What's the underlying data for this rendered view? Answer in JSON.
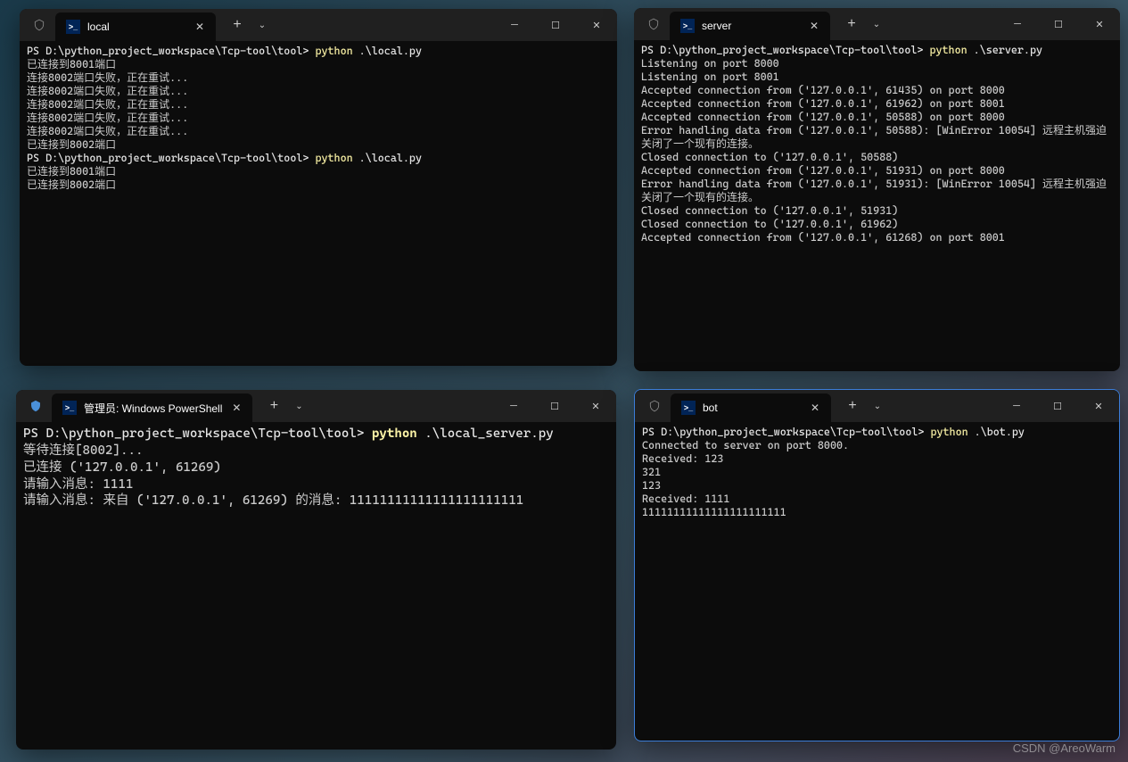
{
  "watermark": "CSDN @AreoWarm",
  "windows": {
    "local": {
      "tab_title": "local",
      "prompt1_path": "PS D:\\python_project_workspace\\Tcp-tool\\tool> ",
      "cmd1_bin": "python",
      "cmd1_arg": " .\\local.py",
      "lines": [
        "已连接到8001端口",
        "连接8002端口失败，正在重试...",
        "连接8002端口失败，正在重试...",
        "连接8002端口失败，正在重试...",
        "连接8002端口失败，正在重试...",
        "连接8002端口失败，正在重试...",
        "已连接到8002端口"
      ],
      "prompt2_path": "PS D:\\python_project_workspace\\Tcp-tool\\tool> ",
      "cmd2_bin": "python",
      "cmd2_arg": " .\\local.py",
      "lines2": [
        "已连接到8001端口",
        "已连接到8002端口"
      ]
    },
    "server": {
      "tab_title": "server",
      "prompt_path": "PS D:\\python_project_workspace\\Tcp-tool\\tool> ",
      "cmd_bin": "python",
      "cmd_arg": " .\\server.py",
      "output": [
        "Listening on port 8000",
        "Listening on port 8001",
        "Accepted connection from ('127.0.0.1', 61435) on port 8000",
        "Accepted connection from ('127.0.0.1', 61962) on port 8001",
        "Accepted connection from ('127.0.0.1', 50588) on port 8000",
        "Error handling data from ('127.0.0.1', 50588): [WinError 10054] 远程主机强迫关闭了一个现有的连接。",
        "Closed connection to ('127.0.0.1', 50588)",
        "Accepted connection from ('127.0.0.1', 51931) on port 8000",
        "Error handling data from ('127.0.0.1', 51931): [WinError 10054] 远程主机强迫关闭了一个现有的连接。",
        "Closed connection to ('127.0.0.1', 51931)",
        "Closed connection to ('127.0.0.1', 61962)",
        "Accepted connection from ('127.0.0.1', 61268) on port 8001"
      ]
    },
    "admin": {
      "tab_title": "管理员: Windows PowerShell",
      "prompt_path": "PS D:\\python_project_workspace\\Tcp-tool\\tool> ",
      "cmd_bin": "python",
      "cmd_arg": " .\\local_server.py",
      "output": [
        "等待连接[8002]...",
        "已连接 ('127.0.0.1', 61269)",
        "请输入消息: 1111",
        "请输入消息: 来自 ('127.0.0.1', 61269) 的消息: 11111111111111111111111"
      ]
    },
    "bot": {
      "tab_title": "bot",
      "prompt_path": "PS D:\\python_project_workspace\\Tcp-tool\\tool> ",
      "cmd_bin": "python",
      "cmd_arg": " .\\bot.py",
      "output": [
        "Connected to server on port 8000.",
        "Received: 123",
        "321",
        "123",
        "Received: 1111",
        "11111111111111111111111"
      ]
    }
  }
}
